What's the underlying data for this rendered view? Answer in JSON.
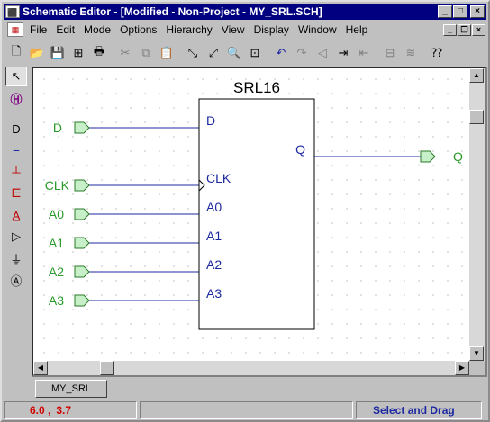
{
  "window": {
    "title": "Schematic Editor - [Modified - Non-Project - MY_SRL.SCH]"
  },
  "menu": {
    "items": [
      "File",
      "Edit",
      "Mode",
      "Options",
      "Hierarchy",
      "View",
      "Display",
      "Window",
      "Help"
    ]
  },
  "schematic": {
    "component_name": "SRL16",
    "input_pins": [
      "D",
      "CLK",
      "A0",
      "A1",
      "A2",
      "A3"
    ],
    "output_pins": [
      "Q"
    ],
    "input_ports": [
      "D",
      "CLK",
      "A0",
      "A1",
      "A2",
      "A3"
    ],
    "output_ports": [
      "Q"
    ],
    "colors": {
      "port": "#c8f0c8",
      "port_label": "#2a9a2a",
      "pin_label": "#1c28a0",
      "wire": "#1c28a0"
    }
  },
  "tabs": [
    "MY_SRL"
  ],
  "status": {
    "x": "6.0 ,",
    "y": "3.7",
    "middle": "",
    "mode": "Select and Drag"
  }
}
